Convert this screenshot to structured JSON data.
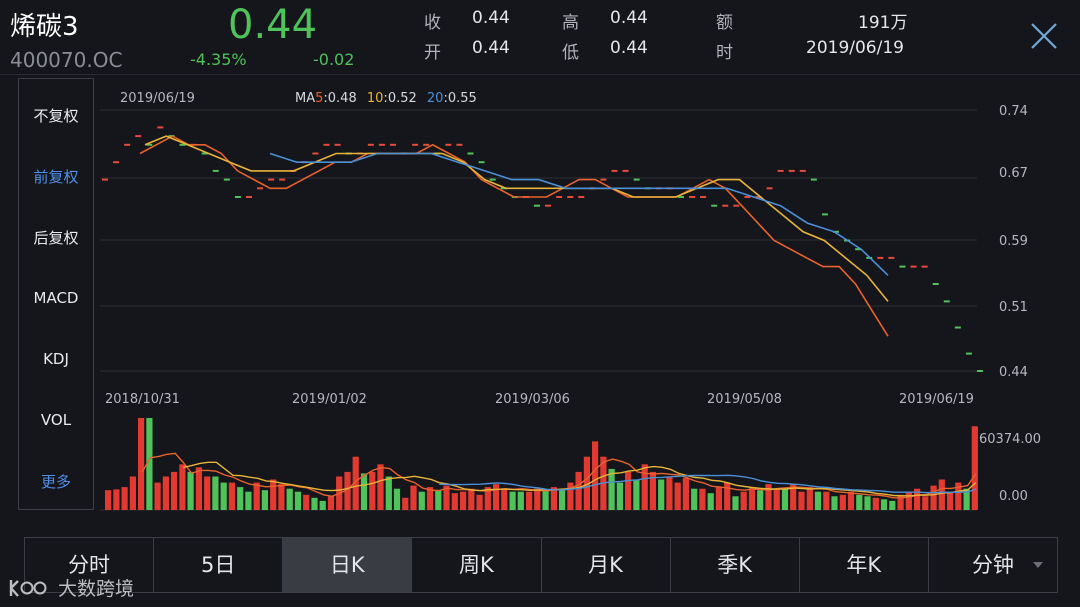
{
  "header": {
    "name": "烯碳3",
    "code": "400070.OC",
    "price": "0.44",
    "change_pct": "-4.35%",
    "change_abs": "-0.02",
    "stats": [
      {
        "label": "收",
        "value": "0.44"
      },
      {
        "label": "高",
        "value": "0.44"
      },
      {
        "label": "额",
        "value": "191万"
      },
      {
        "label": "开",
        "value": "0.44"
      },
      {
        "label": "低",
        "value": "0.44"
      },
      {
        "label": "时",
        "value": "2019/06/19"
      }
    ],
    "close_icon": "close-icon"
  },
  "side_menu": {
    "items": [
      {
        "label": "不复权",
        "active": false
      },
      {
        "label": "前复权",
        "active": true
      },
      {
        "label": "后复权",
        "active": false
      },
      {
        "label": "MACD",
        "active": false
      },
      {
        "label": "KDJ",
        "active": false
      },
      {
        "label": "VOL",
        "active": false
      },
      {
        "label": "更多",
        "active": true
      }
    ]
  },
  "chart": {
    "date_label": "2019/06/19",
    "ma": [
      {
        "name": "MA",
        "period": "5",
        "value": "0.48",
        "color": "#e8622c"
      },
      {
        "name": "",
        "period": "10",
        "value": "0.52",
        "color": "#e8b339"
      },
      {
        "name": "",
        "period": "20",
        "value": "0.55",
        "color": "#4a90d9"
      }
    ],
    "y_ticks": [
      {
        "label": "0.74",
        "color": "#e84a3c"
      },
      {
        "label": "0.67",
        "color": "#e84a3c"
      },
      {
        "label": "0.59",
        "color": "#d6d8dd"
      },
      {
        "label": "0.51",
        "color": "#4fc25a"
      },
      {
        "label": "0.44",
        "color": "#4fc25a"
      }
    ],
    "x_ticks": [
      "2018/10/31",
      "2019/01/02",
      "2019/03/06",
      "2019/05/08",
      "2019/06/19"
    ],
    "volume_ticks": [
      "60374.00",
      "0.00"
    ]
  },
  "chart_data": {
    "type": "candlestick",
    "price_range": [
      0.44,
      0.74
    ],
    "x_range": [
      "2018/10/31",
      "2019/06/19"
    ],
    "close": [
      0.66,
      0.68,
      0.7,
      0.71,
      0.7,
      0.72,
      0.71,
      0.7,
      0.7,
      0.69,
      0.67,
      0.66,
      0.64,
      0.64,
      0.65,
      0.66,
      0.66,
      0.67,
      0.68,
      0.69,
      0.7,
      0.7,
      0.69,
      0.69,
      0.7,
      0.7,
      0.7,
      0.69,
      0.7,
      0.7,
      0.69,
      0.7,
      0.7,
      0.69,
      0.68,
      0.66,
      0.65,
      0.64,
      0.64,
      0.63,
      0.63,
      0.64,
      0.64,
      0.64,
      0.65,
      0.66,
      0.67,
      0.67,
      0.66,
      0.65,
      0.65,
      0.65,
      0.64,
      0.64,
      0.64,
      0.63,
      0.63,
      0.63,
      0.64,
      0.64,
      0.65,
      0.67,
      0.67,
      0.67,
      0.66,
      0.62,
      0.6,
      0.59,
      0.58,
      0.57,
      0.57,
      0.57,
      0.56,
      0.56,
      0.56,
      0.54,
      0.52,
      0.49,
      0.46,
      0.44
    ],
    "ma5": [
      0.69,
      0.7,
      0.71,
      0.7,
      0.7,
      0.69,
      0.67,
      0.66,
      0.65,
      0.65,
      0.66,
      0.67,
      0.68,
      0.68,
      0.69,
      0.69,
      0.69,
      0.69,
      0.7,
      0.69,
      0.68,
      0.66,
      0.65,
      0.64,
      0.64,
      0.64,
      0.65,
      0.66,
      0.66,
      0.65,
      0.64,
      0.64,
      0.64,
      0.64,
      0.65,
      0.66,
      0.65,
      0.63,
      0.61,
      0.59,
      0.58,
      0.57,
      0.56,
      0.56,
      0.54,
      0.51,
      0.48
    ],
    "ma10": [
      0.7,
      0.71,
      0.7,
      0.69,
      0.68,
      0.67,
      0.67,
      0.67,
      0.68,
      0.69,
      0.69,
      0.69,
      0.69,
      0.69,
      0.69,
      0.68,
      0.66,
      0.65,
      0.65,
      0.65,
      0.65,
      0.65,
      0.65,
      0.64,
      0.64,
      0.64,
      0.65,
      0.66,
      0.66,
      0.64,
      0.62,
      0.6,
      0.59,
      0.57,
      0.55,
      0.52
    ],
    "ma20": [
      0.69,
      0.68,
      0.68,
      0.68,
      0.69,
      0.69,
      0.69,
      0.68,
      0.67,
      0.66,
      0.66,
      0.65,
      0.65,
      0.65,
      0.65,
      0.65,
      0.65,
      0.65,
      0.64,
      0.63,
      0.61,
      0.6,
      0.58,
      0.55
    ],
    "volume_max": 60374.0,
    "volume": [
      13000,
      13500,
      15000,
      22000,
      60374,
      60374,
      18000,
      22000,
      25000,
      30000,
      25000,
      28000,
      22000,
      22000,
      18000,
      18000,
      15000,
      12000,
      18000,
      13000,
      20000,
      17000,
      14000,
      12000,
      10000,
      8000,
      6000,
      9000,
      22000,
      25000,
      35000,
      24000,
      25000,
      30000,
      22000,
      14000,
      8000,
      16000,
      12000,
      15000,
      13000,
      16000,
      11000,
      12000,
      14000,
      10000,
      15000,
      17000,
      14000,
      12000,
      12000,
      12000,
      14000,
      13000,
      15000,
      13000,
      18000,
      25000,
      35000,
      45000,
      35000,
      27000,
      18000,
      25000,
      20000,
      30000,
      25000,
      20000,
      22000,
      18000,
      21000,
      14000,
      14000,
      11000,
      15000,
      18000,
      9000,
      12000,
      15000,
      13000,
      17000,
      14000,
      14000,
      17000,
      12000,
      15000,
      12000,
      12000,
      9000,
      10000,
      12000,
      10000,
      9000,
      8000,
      7000,
      6000,
      10000,
      12000,
      14000,
      9000,
      16000,
      20000,
      12000,
      18000,
      14000,
      55000
    ]
  },
  "tabs": [
    {
      "label": "分时",
      "active": false
    },
    {
      "label": "5日",
      "active": false
    },
    {
      "label": "日K",
      "active": true
    },
    {
      "label": "周K",
      "active": false
    },
    {
      "label": "月K",
      "active": false
    },
    {
      "label": "季K",
      "active": false
    },
    {
      "label": "年K",
      "active": false
    },
    {
      "label": "分钟",
      "active": false,
      "dropdown": true
    }
  ],
  "watermark": {
    "text": "大数跨境"
  }
}
